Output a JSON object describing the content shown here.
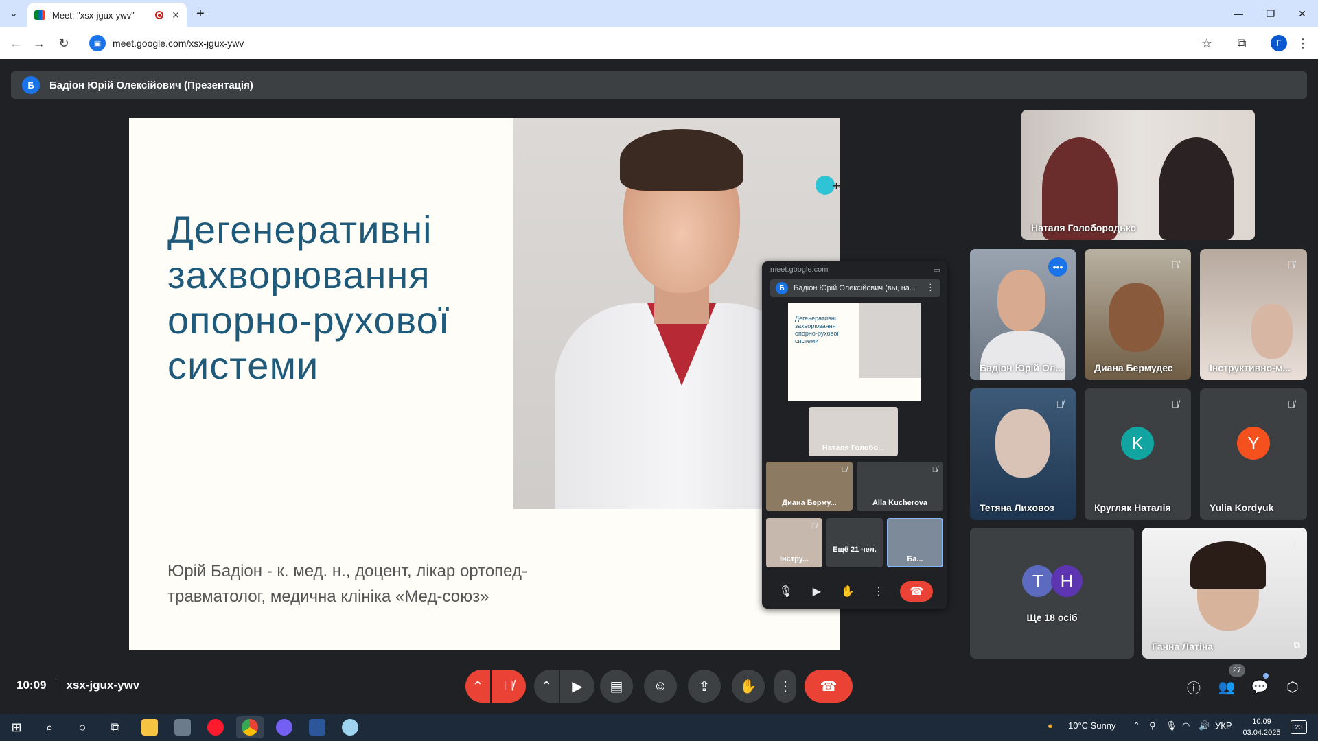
{
  "browser": {
    "tab_title": "Meet: \"xsx-jgux-ywv\"",
    "url": "meet.google.com/xsx-jgux-ywv",
    "profile_initial": "Г"
  },
  "meet": {
    "presenter": {
      "initial": "Б",
      "label": "Бадіон Юрій Олексійович (Презентація)"
    },
    "slide": {
      "title": "Дегенеративні захворювання опорно-рухової системи",
      "subtitle": "Юрій Бадіон - к. мед. н., доцент, лікар ортопед-травматолог, медична клініка «Мед-союз»"
    },
    "participants": [
      {
        "name": "Наталя Голобородько",
        "muted": false
      },
      {
        "name": "Бадіон Юрій Ол...",
        "speaking": true
      },
      {
        "name": "Диана Бермудес",
        "muted": true
      },
      {
        "name": "Інструктивно-м...",
        "muted": true
      },
      {
        "name": "Тетяна Лиховоз",
        "muted": true
      },
      {
        "name": "Кругляк Наталія",
        "initial": "K",
        "muted": true
      },
      {
        "name": "Yulia Kordyuk",
        "initial": "Y",
        "muted": true
      },
      {
        "name": "Ще 18 осіб",
        "initials": [
          "T",
          "H"
        ]
      },
      {
        "name": "Ганна Латіна",
        "muted": true
      }
    ],
    "pip": {
      "url": "meet.google.com",
      "presenter_label": "Бадіон Юрій Олексійович (вы, на...",
      "slide_title": "Дегенеративні захворювання опорно-рухової системи",
      "tiles": [
        {
          "name": "Наталя Голобо..."
        },
        {
          "name": "Диана Берму..."
        },
        {
          "name": "Alla Kucherova"
        },
        {
          "name": "Інстру..."
        },
        {
          "name": "Ещё 21 чел."
        },
        {
          "name": "Ба..."
        }
      ]
    },
    "bottom": {
      "time": "10:09",
      "meeting_code": "xsx-jgux-ywv",
      "people_count": "27"
    },
    "colors": {
      "accent": "#1a73e8",
      "end_call": "#ea4335",
      "background": "#202124",
      "tile": "#3c4043"
    }
  },
  "taskbar": {
    "weather": "10°C  Sunny",
    "language": "УКР",
    "clock_time": "10:09",
    "clock_date": "03.04.2025",
    "notifications": "23"
  }
}
